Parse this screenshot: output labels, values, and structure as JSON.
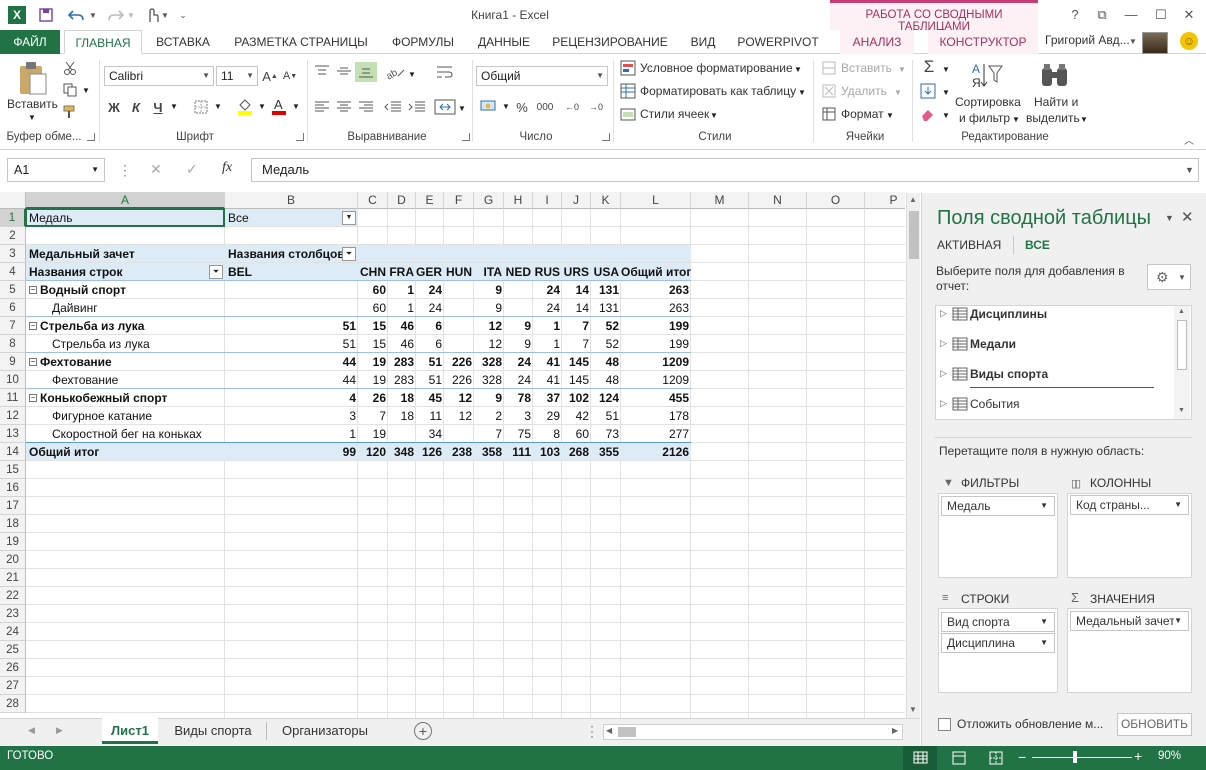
{
  "app": {
    "title": "Книга1 - Excel",
    "logo": "X",
    "context_tools": "РАБОТА СО СВОДНЫМИ ТАБЛИЦАМИ",
    "user_name": "Григорий Авд...",
    "smiley": "☺"
  },
  "window_buttons": {
    "help": "?",
    "restore": "⧉",
    "minimize": "—",
    "maximize": "☐",
    "close": "✕"
  },
  "tabs": {
    "file": "ФАЙЛ",
    "home": "ГЛАВНАЯ",
    "insert": "ВСТАВКА",
    "layout": "РАЗМЕТКА СТРАНИЦЫ",
    "formulas": "ФОРМУЛЫ",
    "data": "ДАННЫЕ",
    "review": "РЕЦЕНЗИРОВАНИЕ",
    "view": "ВИД",
    "powerpivot": "POWERPIVOT",
    "analyze": "АНАЛИЗ",
    "design": "КОНСТРУКТОР"
  },
  "ribbon": {
    "clipboard": {
      "paste": "Вставить",
      "label": "Буфер обме..."
    },
    "font": {
      "name": "Calibri",
      "size": "11",
      "bold": "Ж",
      "italic": "К",
      "underline": "Ч",
      "label": "Шрифт"
    },
    "alignment": {
      "label": "Выравнивание"
    },
    "number": {
      "format": "Общий",
      "label": "Число"
    },
    "styles": {
      "conditional": "Условное форматирование",
      "as_table": "Форматировать как таблицу",
      "cell_styles": "Стили ячеек",
      "label": "Стили"
    },
    "cells": {
      "insert": "Вставить",
      "delete": "Удалить",
      "format": "Формат",
      "label": "Ячейки"
    },
    "editing": {
      "sort1": "Сортировка",
      "sort2": "и фильтр",
      "find1": "Найти и",
      "find2": "выделить",
      "label": "Редактирование"
    }
  },
  "formula_bar": {
    "name_box": "A1",
    "fx": "fx",
    "value": "Медаль"
  },
  "columns": [
    "A",
    "B",
    "C",
    "D",
    "E",
    "F",
    "G",
    "H",
    "I",
    "J",
    "K",
    "L",
    "M",
    "N",
    "O",
    "P"
  ],
  "rows": [
    "1",
    "2",
    "3",
    "4",
    "5",
    "6",
    "7",
    "8",
    "9",
    "10",
    "11",
    "12",
    "13",
    "14",
    "15",
    "16",
    "17",
    "18",
    "19",
    "20",
    "21",
    "22",
    "23",
    "24",
    "25",
    "26",
    "27",
    "28"
  ],
  "pivot": {
    "filter_label": "Медаль",
    "filter_value": "Все",
    "values_label": "Медальный зачет",
    "col_labels": "Названия столбцов",
    "row_labels": "Названия строк",
    "countries": [
      "BEL",
      "CHN",
      "FRA",
      "GER",
      "HUN",
      "ITA",
      "NED",
      "RUS",
      "URS",
      "USA",
      "Общий итог"
    ],
    "body": [
      {
        "label": "Водный спорт",
        "level": 0,
        "values": [
          "",
          "60",
          "1",
          "24",
          "",
          "9",
          "",
          "24",
          "14",
          "131",
          "263"
        ]
      },
      {
        "label": "Дайвинг",
        "level": 1,
        "values": [
          "",
          "60",
          "1",
          "24",
          "",
          "9",
          "",
          "24",
          "14",
          "131",
          "263"
        ]
      },
      {
        "label": "Стрельба из лука",
        "level": 0,
        "values": [
          "51",
          "15",
          "46",
          "6",
          "",
          "12",
          "9",
          "1",
          "7",
          "52",
          "199"
        ]
      },
      {
        "label": "Стрельба из лука",
        "level": 1,
        "values": [
          "51",
          "15",
          "46",
          "6",
          "",
          "12",
          "9",
          "1",
          "7",
          "52",
          "199"
        ]
      },
      {
        "label": "Фехтование",
        "level": 0,
        "values": [
          "44",
          "19",
          "283",
          "51",
          "226",
          "328",
          "24",
          "41",
          "145",
          "48",
          "1209"
        ]
      },
      {
        "label": "Фехтование",
        "level": 1,
        "values": [
          "44",
          "19",
          "283",
          "51",
          "226",
          "328",
          "24",
          "41",
          "145",
          "48",
          "1209"
        ]
      },
      {
        "label": "Конькобежный спорт",
        "level": 0,
        "values": [
          "4",
          "26",
          "18",
          "45",
          "12",
          "9",
          "78",
          "37",
          "102",
          "124",
          "455"
        ]
      },
      {
        "label": "Фигурное катание",
        "level": 1,
        "values": [
          "3",
          "7",
          "18",
          "11",
          "12",
          "2",
          "3",
          "29",
          "42",
          "51",
          "178"
        ]
      },
      {
        "label": "Скоростной бег на коньках",
        "level": 1,
        "values": [
          "1",
          "19",
          "",
          "34",
          "",
          "7",
          "75",
          "8",
          "60",
          "73",
          "277"
        ]
      }
    ],
    "grand_total": {
      "label": "Общий итог",
      "values": [
        "99",
        "120",
        "348",
        "126",
        "238",
        "358",
        "111",
        "103",
        "268",
        "355",
        "2126"
      ]
    }
  },
  "sheets": {
    "active": "Лист1",
    "s2": "Виды спорта",
    "s3": "Организаторы"
  },
  "pane": {
    "title": "Поля сводной таблицы",
    "tab_active": "АКТИВНАЯ",
    "tab_all": "ВСЕ",
    "choose_fields": "Выберите поля для добавления в отчет:",
    "tables": [
      "Дисциплины",
      "Медали",
      "Виды спорта",
      "События"
    ],
    "drag_hint": "Перетащите поля в нужную область:",
    "filters_label": "ФИЛЬТРЫ",
    "columns_label": "КОЛОННЫ",
    "rows_label": "СТРОКИ",
    "values_label": "ЗНАЧЕНИЯ",
    "filters": [
      "Медаль"
    ],
    "columns": [
      "Код страны..."
    ],
    "rows": [
      "Вид спорта",
      "Дисциплина"
    ],
    "values": [
      "Медальный зачет"
    ],
    "defer": "Отложить обновление м...",
    "update": "ОБНОВИТЬ"
  },
  "status": {
    "ready": "ГОТОВО",
    "zoom": "90%"
  }
}
